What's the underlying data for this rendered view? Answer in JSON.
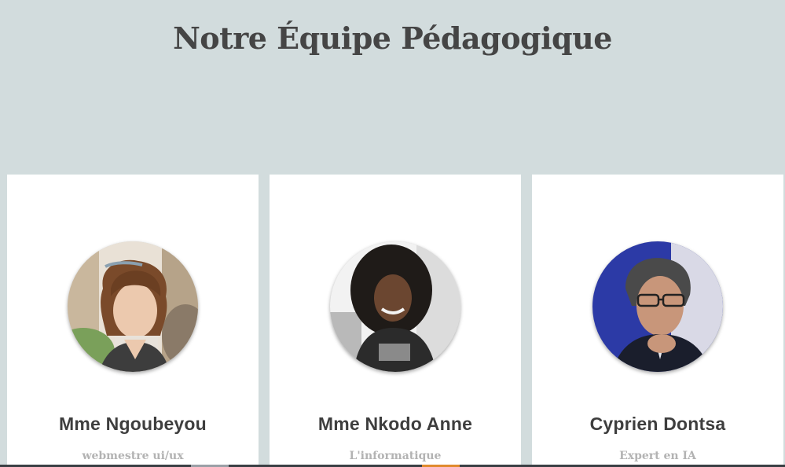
{
  "page": {
    "title": "Notre Équipe Pédagogique"
  },
  "team": [
    {
      "name": "Mme Ngoubeyou",
      "role": "webmestre ui/ux",
      "avatar_icon": "avatar-photo-woman-curly-hair"
    },
    {
      "name": "Mme Nkodo Anne",
      "role": "L'informatique",
      "avatar_icon": "avatar-photo-woman-afro"
    },
    {
      "name": "Cyprien Dontsa",
      "role": "Expert en IA",
      "avatar_icon": "avatar-photo-man-glasses"
    }
  ],
  "colors": {
    "background": "#d2dcdd",
    "card": "#ffffff",
    "title": "#454545",
    "name": "#3e3e3e",
    "role": "#b3b3b3"
  }
}
